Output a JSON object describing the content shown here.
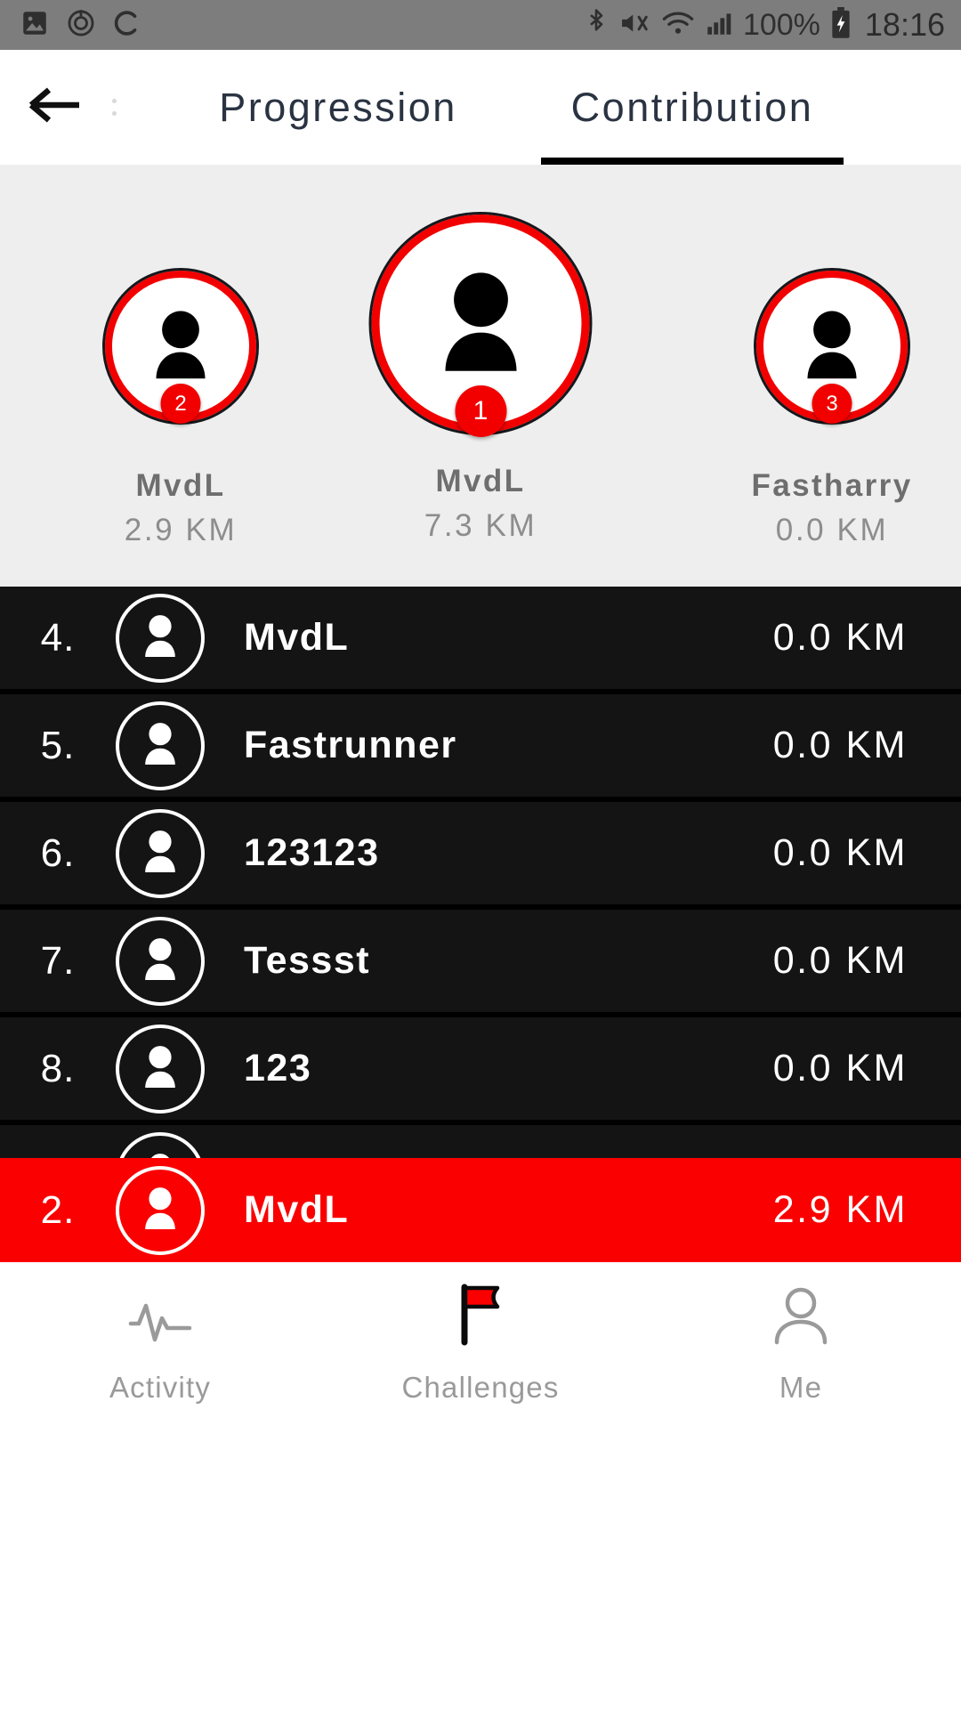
{
  "statusbar": {
    "icons": [
      "image-icon",
      "alarm-icon",
      "sync-icon",
      "bluetooth-icon",
      "mute-icon",
      "wifi-icon",
      "signal-icon"
    ],
    "battery_percent": "100%",
    "battery_icon": "battery-charging-icon",
    "clock": "18:16"
  },
  "appbar": {
    "back_icon": "back-arrow-icon",
    "overflow_icon": "overflow-menu-icon",
    "tabs": [
      {
        "id": "progression",
        "label": "Progression",
        "active": false
      },
      {
        "id": "contribution",
        "label": "Contribution",
        "active": true
      }
    ]
  },
  "podium": [
    {
      "rank": "2",
      "name": "MvdL",
      "distance": "2.9 KM",
      "avatar_icon": "person-avatar-icon"
    },
    {
      "rank": "1",
      "name": "MvdL",
      "distance": "7.3 KM",
      "avatar_icon": "person-avatar-icon"
    },
    {
      "rank": "3",
      "name": "Fastharry",
      "distance": "0.0 KM",
      "avatar_icon": "person-avatar-icon"
    }
  ],
  "leaderboard": {
    "rows": [
      {
        "rank": "4.",
        "name": "MvdL",
        "distance": "0.0 KM",
        "avatar_icon": "person-avatar-icon",
        "highlight": false
      },
      {
        "rank": "5.",
        "name": "Fastrunner",
        "distance": "0.0 KM",
        "avatar_icon": "person-avatar-icon",
        "highlight": false
      },
      {
        "rank": "6.",
        "name": "123123",
        "distance": "0.0 KM",
        "avatar_icon": "person-avatar-icon",
        "highlight": false
      },
      {
        "rank": "7.",
        "name": "Tessst",
        "distance": "0.0 KM",
        "avatar_icon": "person-avatar-icon",
        "highlight": false
      },
      {
        "rank": "8.",
        "name": "123",
        "distance": "0.0 KM",
        "avatar_icon": "person-avatar-icon",
        "highlight": false
      }
    ],
    "current_user_row": {
      "rank": "2.",
      "name": "MvdL",
      "distance": "2.9 KM",
      "avatar_icon": "person-avatar-icon",
      "highlight": true
    }
  },
  "bottomnav": [
    {
      "id": "activity",
      "label": "Activity",
      "icon": "pulse-icon",
      "active": false
    },
    {
      "id": "challenges",
      "label": "Challenges",
      "icon": "flag-icon",
      "active": true
    },
    {
      "id": "me",
      "label": "Me",
      "icon": "person-icon",
      "active": false
    }
  ],
  "colors": {
    "accent_red": "#fa0000",
    "list_row_bg": "#141414",
    "list_gap": "#000000",
    "podium_bg": "#eeeeee",
    "statusbar_bg": "#7d7d7d",
    "tab_text": "#2a3342"
  }
}
